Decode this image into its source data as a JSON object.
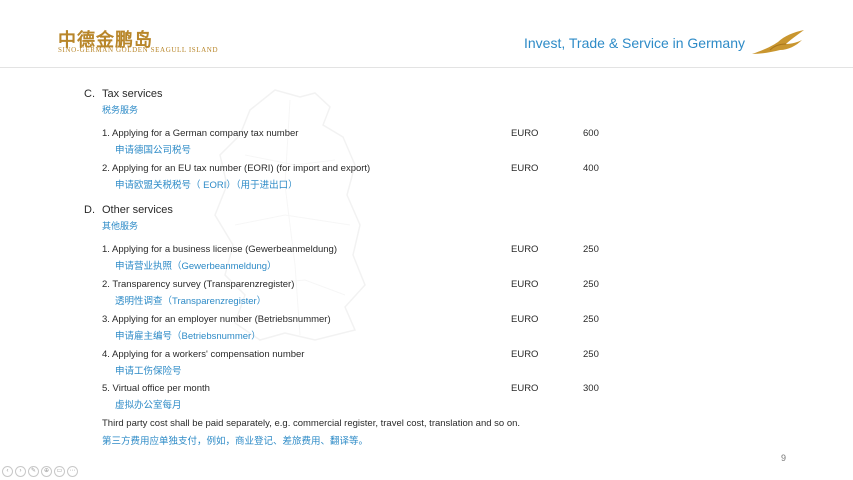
{
  "header": {
    "logo_cn": "中德金鹏岛",
    "logo_en": "SINO-GERMAN GOLDEN SEAGULL ISLAND",
    "tagline": "Invest, Trade & Service in Germany"
  },
  "sections": [
    {
      "letter": "C.",
      "title": "Tax services",
      "title_cn": "税务服务",
      "items": [
        {
          "en": "1. Applying for a German company tax number",
          "cn": "申请德国公司税号",
          "currency": "EURO",
          "price": "600"
        },
        {
          "en": "2. Applying for an EU tax number (EORI) (for import and export)",
          "cn": "申请欧盟关税税号（ EORI）（用于进出口）",
          "currency": "EURO",
          "price": "400"
        }
      ]
    },
    {
      "letter": "D.",
      "title": "Other services",
      "title_cn": "其他服务",
      "items": [
        {
          "en": "1. Applying for a business license (Gewerbeanmeldung)",
          "cn": "申请营业执照（Gewerbeanmeldung）",
          "currency": "EURO",
          "price": "250"
        },
        {
          "en": "2. Transparency survey (Transparenzregister)",
          "cn": "透明性调查（Transparenzregister）",
          "currency": "EURO",
          "price": "250"
        },
        {
          "en": "3. Applying for an employer number (Betriebsnummer)",
          "cn": "申请雇主编号（Betriebsnummer）",
          "currency": "EURO",
          "price": "250"
        },
        {
          "en": "4. Applying for a workers' compensation number",
          "cn": "申请工伤保险号",
          "currency": "EURO",
          "price": "250"
        },
        {
          "en": "5.  Virtual office per month",
          "cn": "虚拟办公室每月",
          "currency": "EURO",
          "price": "300"
        }
      ]
    }
  ],
  "note": {
    "en": "Third party cost shall be paid separately, e.g. commercial register, travel cost, translation and so on.",
    "cn": "第三方费用应单独支付，例如，商业登记、差旅费用、翻译等。"
  },
  "page_number": "9",
  "toolbar": {
    "icons": [
      "prev-slide-icon",
      "next-slide-icon",
      "pen-icon",
      "zoom-icon",
      "view-icon",
      "menu-icon"
    ],
    "glyphs": [
      "‹",
      "›",
      "✎",
      "⊕",
      "▭",
      "⋯"
    ]
  },
  "colors": {
    "accent_gold": "#b8862a",
    "accent_blue": "#2e8bc7",
    "text": "#2a2a2a"
  }
}
